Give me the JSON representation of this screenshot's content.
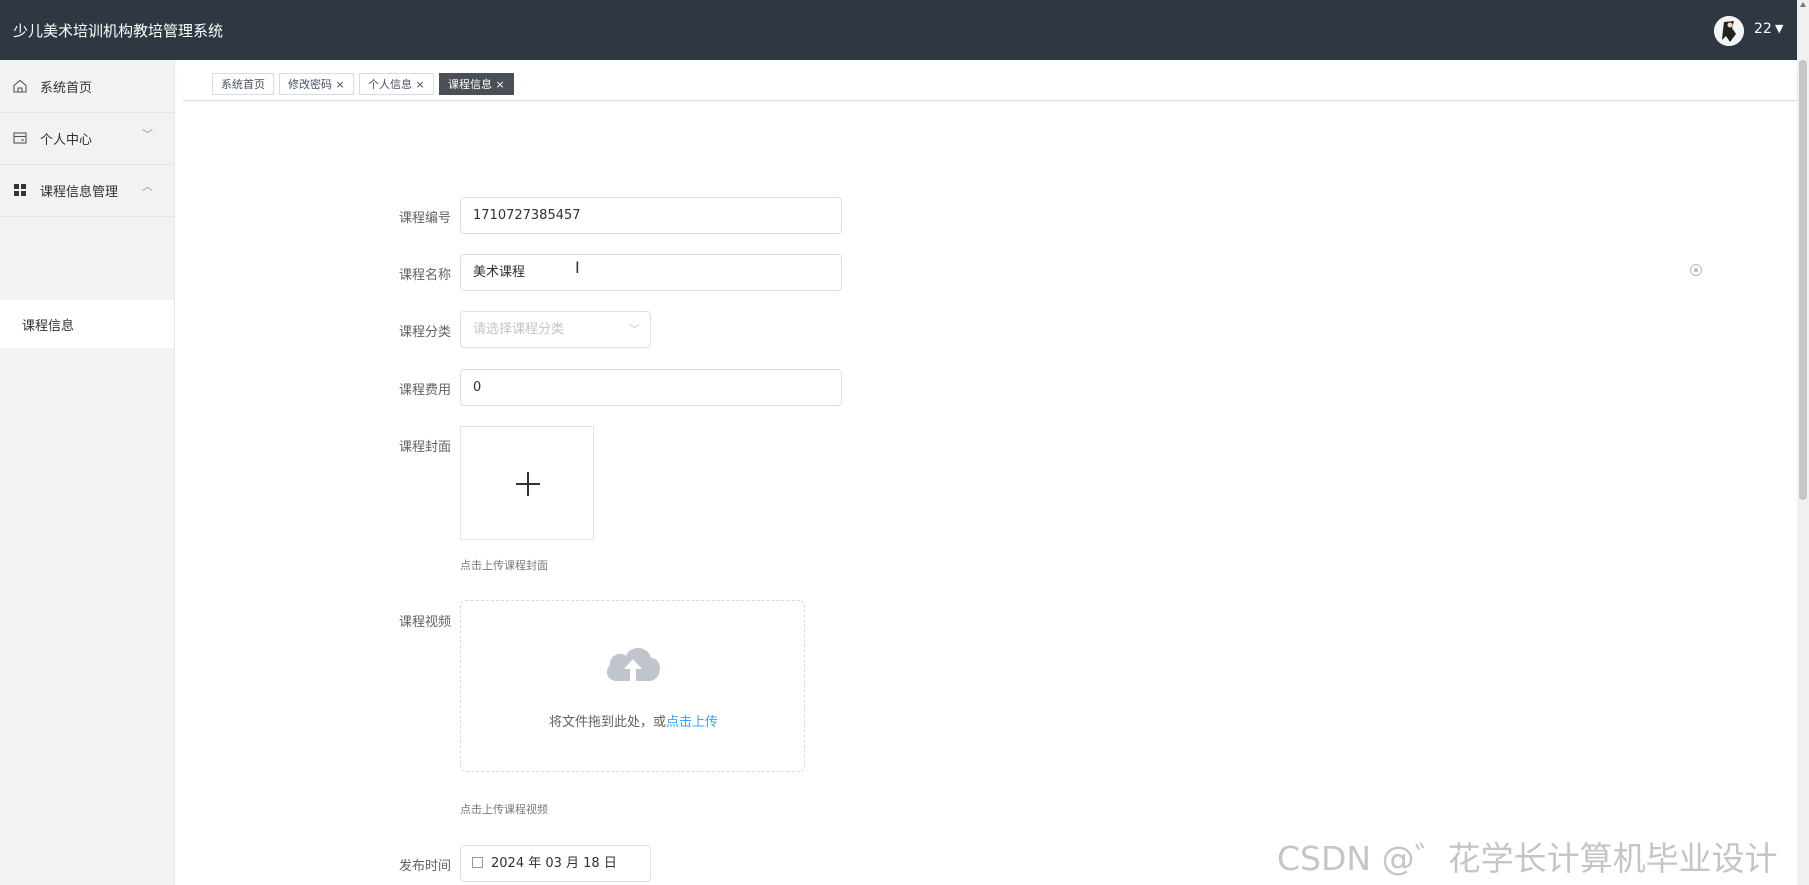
{
  "header": {
    "app_title": "少儿美术培训机构教培管理系统",
    "user_name": "22"
  },
  "sidebar": {
    "items": [
      {
        "label": "系统首页",
        "icon": "home-icon"
      },
      {
        "label": "个人中心",
        "icon": "card-icon"
      },
      {
        "label": "课程信息管理",
        "icon": "grid-icon"
      }
    ],
    "submenu": {
      "label": "课程信息"
    }
  },
  "tabs": [
    {
      "label": "系统首页"
    },
    {
      "label": "修改密码 ×"
    },
    {
      "label": "个人信息 ×"
    },
    {
      "label": "课程信息 ×"
    }
  ],
  "form": {
    "course_no": {
      "label": "课程编号",
      "value": "1710727385457"
    },
    "course_name": {
      "label": "课程名称",
      "value": "美术课程"
    },
    "course_category": {
      "label": "课程分类",
      "placeholder": "请选择课程分类"
    },
    "course_fee": {
      "label": "课程费用",
      "value": "0"
    },
    "course_cover": {
      "label": "课程封面",
      "hint": "点击上传课程封面"
    },
    "course_video": {
      "label": "课程视频",
      "drop_text": "将文件拖到此处，或",
      "drop_link": "点击上传",
      "hint": "点击上传课程视频"
    },
    "publish_time": {
      "label": "发布时间",
      "value": "2024 年 03 月 18 日"
    }
  },
  "watermark": "CSDN @゛花学长计算机毕业设计",
  "colors": {
    "topbar": "#2f3742",
    "sidebar": "#f2f2f2",
    "active_tab": "#4a4f56",
    "link": "#409eff"
  }
}
